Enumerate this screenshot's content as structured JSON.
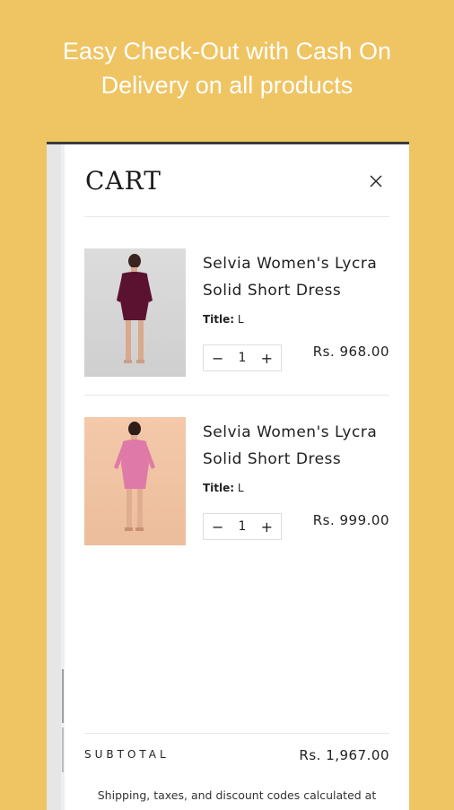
{
  "banner": {
    "line1": "Easy Check-Out with Cash On",
    "line2": "Delivery on all products"
  },
  "cart": {
    "title": "CART",
    "close_icon": "close-icon",
    "items": [
      {
        "name": "Selvia Women's Lycra Solid Short Dress",
        "variant_label": "Title:",
        "variant_value": "L",
        "quantity": "1",
        "price": "Rs. 968.00",
        "image": "woman-in-wine-dress"
      },
      {
        "name": "Selvia Women's Lycra Solid Short Dress",
        "variant_label": "Title:",
        "variant_value": "L",
        "quantity": "1",
        "price": "Rs. 999.00",
        "image": "woman-in-pink-dress"
      }
    ],
    "qty_minus": "−",
    "qty_plus": "+",
    "subtotal_label": "SUBTOTAL",
    "subtotal_value": "Rs. 1,967.00",
    "note": "Shipping, taxes, and discount codes calculated at"
  },
  "colors": {
    "background": "#efc462",
    "drawer": "#ffffff",
    "text": "#1f1f1f"
  }
}
